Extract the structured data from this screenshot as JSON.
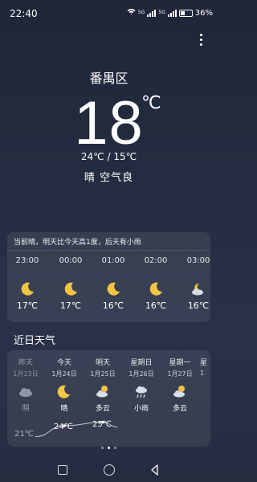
{
  "status": {
    "time": "22:40",
    "network_a": "5G",
    "network_b": "5G",
    "battery": "36%"
  },
  "location": {
    "city": "番禺区"
  },
  "current": {
    "temp": "18",
    "unit": "℃",
    "range": "24℃ / 15℃",
    "condition": "晴",
    "air": "空气良"
  },
  "hourly": {
    "tip": "当前晴，明天比今天高1度，后天有小雨",
    "items": [
      {
        "time": "23:00",
        "icon": "moon-icon",
        "temp": "17℃"
      },
      {
        "time": "00:00",
        "icon": "moon-icon",
        "temp": "17℃"
      },
      {
        "time": "01:00",
        "icon": "moon-icon",
        "temp": "16℃"
      },
      {
        "time": "02:00",
        "icon": "moon-icon",
        "temp": "16℃"
      },
      {
        "time": "03:00",
        "icon": "partly-cloudy-icon",
        "temp": "16℃"
      }
    ]
  },
  "daily": {
    "title": "近日天气",
    "items": [
      {
        "name": "昨天",
        "date": "1月23日",
        "icon": "cloudy-icon",
        "cond": "阴",
        "high": "21℃",
        "high_value": 21
      },
      {
        "name": "今天",
        "date": "1月24日",
        "icon": "moon-icon",
        "cond": "晴",
        "high": "24℃",
        "high_value": 24
      },
      {
        "name": "明天",
        "date": "1月25日",
        "icon": "partly-cloudy-icon",
        "cond": "多云",
        "high": "25℃",
        "high_value": 25
      },
      {
        "name": "星期日",
        "date": "1月26日",
        "icon": "light-rain-icon",
        "cond": "小雨",
        "high": "",
        "high_value": null
      },
      {
        "name": "星期一",
        "date": "1月27日",
        "icon": "partly-cloudy-icon",
        "cond": "多云",
        "high": "",
        "high_value": null
      },
      {
        "name": "星",
        "date": "1",
        "icon": "",
        "cond": "",
        "high": "",
        "high_value": null
      }
    ]
  },
  "colors": {
    "moon": "#f5c542",
    "sun": "#f5c542",
    "cloud": "#d9dde5"
  }
}
